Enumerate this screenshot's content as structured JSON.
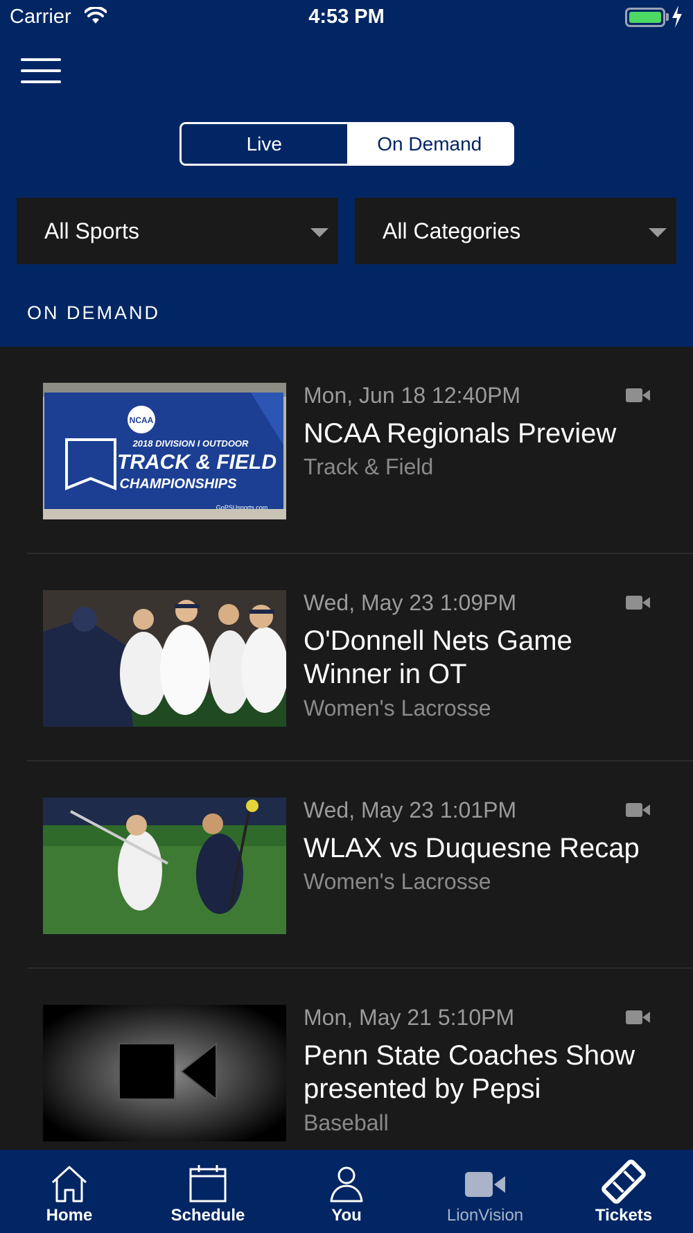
{
  "status_bar": {
    "carrier": "Carrier",
    "time": "4:53 PM",
    "battery_icon": "battery-charging-icon"
  },
  "header": {
    "menu_icon": "hamburger-icon",
    "segments": [
      {
        "label": "Live",
        "selected": false
      },
      {
        "label": "On Demand",
        "selected": true
      }
    ],
    "filters": {
      "sports": "All Sports",
      "categories": "All Categories"
    },
    "section_title": "ON DEMAND"
  },
  "videos": [
    {
      "date": "Mon, Jun 18 12:40PM",
      "title": "NCAA Regionals Preview",
      "sport": "Track & Field",
      "thumbnail_text": [
        "NCAA",
        "2018 DIVISION I OUTDOOR",
        "TRACK & FIELD",
        "CHAMPIONSHIPS",
        "GoPSUsports.com"
      ]
    },
    {
      "date": "Wed, May 23 1:09PM",
      "title": "O'Donnell Nets Game Winner in OT",
      "sport": "Women's Lacrosse"
    },
    {
      "date": "Wed, May 23 1:01PM",
      "title": "WLAX vs Duquesne Recap",
      "sport": "Women's Lacrosse"
    },
    {
      "date": "Mon, May 21 5:10PM",
      "title": "Penn State Coaches Show presented by Pepsi",
      "sport": "Baseball"
    }
  ],
  "tabbar": [
    {
      "label": "Home",
      "icon": "home-icon"
    },
    {
      "label": "Schedule",
      "icon": "calendar-icon"
    },
    {
      "label": "You",
      "icon": "person-icon"
    },
    {
      "label": "LionVision",
      "icon": "video-camera-icon"
    },
    {
      "label": "Tickets",
      "icon": "ticket-icon"
    }
  ],
  "colors": {
    "navy": "#022664",
    "background": "#1a1a1a",
    "secondary_text": "#9b9b9b"
  }
}
